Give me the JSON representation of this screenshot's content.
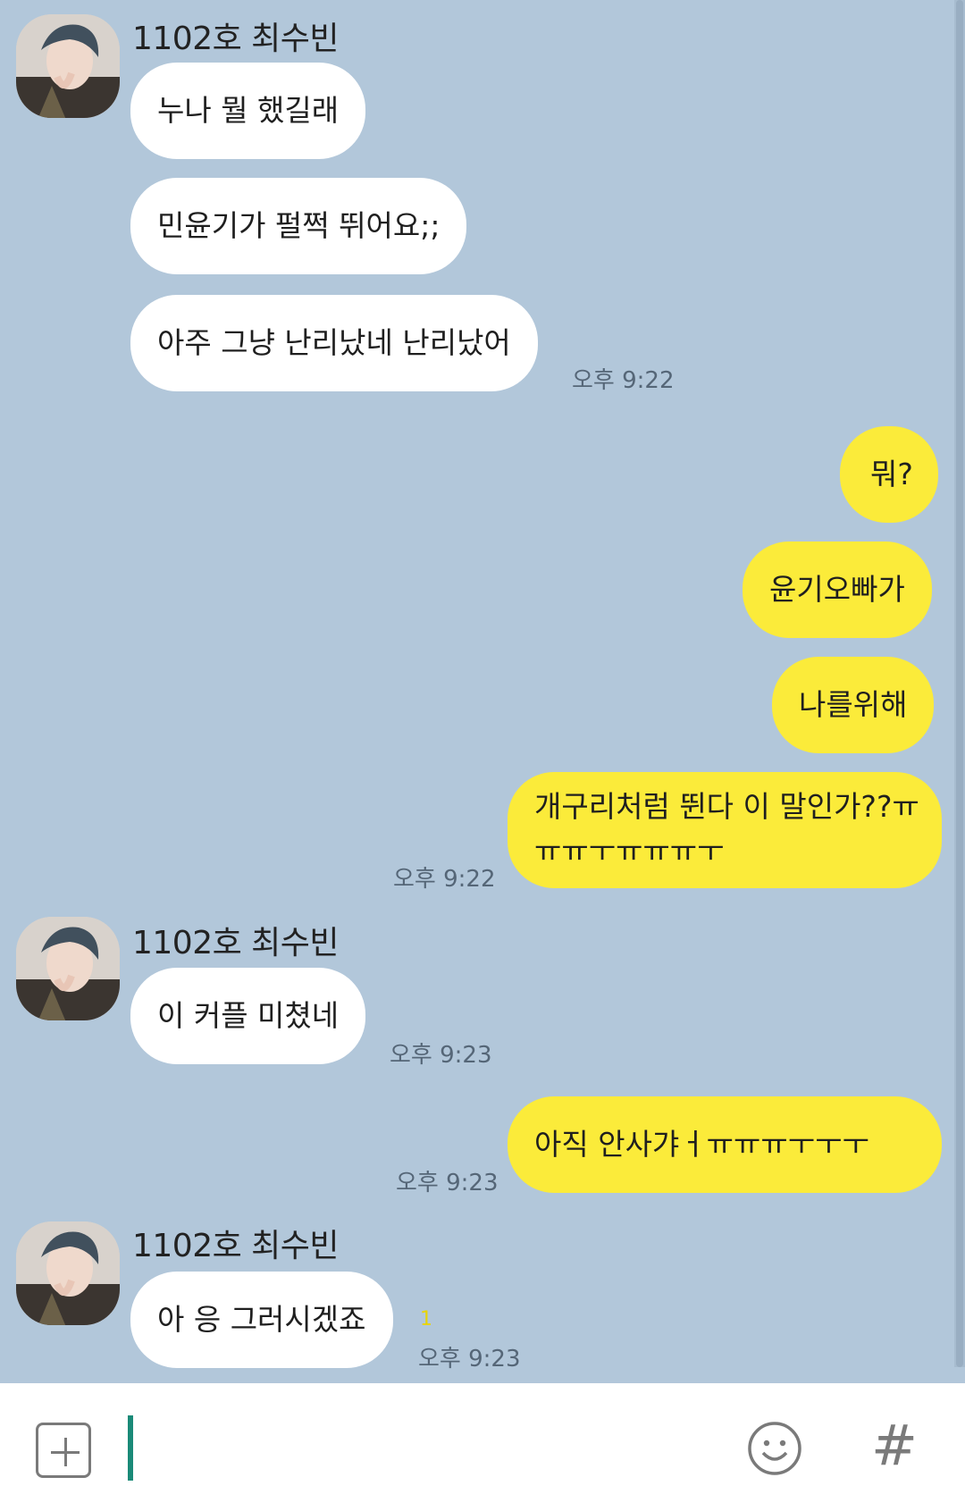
{
  "sender_name": "1102호 최수빈",
  "messages": {
    "m1": "누나 뭘 했길래",
    "m2": "민윤기가 펄쩍 뛰어요;;",
    "m3": "아주 그냥 난리났네 난리났어",
    "t1": "오후 9:22",
    "m4": "뭐?",
    "m5": "윤기오빠가",
    "m6": "나를위해",
    "m7": "개구리처럼 뛴다 이 말인가??ㅠㅠㅠㅜㅠㅠㅠㅜ",
    "t2": "오후 9:22",
    "m8": "이 커플 미쳤네",
    "t3": "오후 9:23",
    "m9": "아직 안사갸ㅓㅠㅠㅠㅜㅜㅜ",
    "t4": "오후 9:23",
    "m10": "아 응 그러시겠죠",
    "unread": "1",
    "t5": "오후 9:23"
  },
  "input": {
    "placeholder": ""
  },
  "icons": {
    "plus": "plus-icon",
    "emoji": "emoji-icon",
    "hash": "#"
  },
  "colors": {
    "background": "#b2c7da",
    "outgoing": "#fbeb3a",
    "incoming": "#ffffff",
    "cursor": "#1a8a78"
  }
}
